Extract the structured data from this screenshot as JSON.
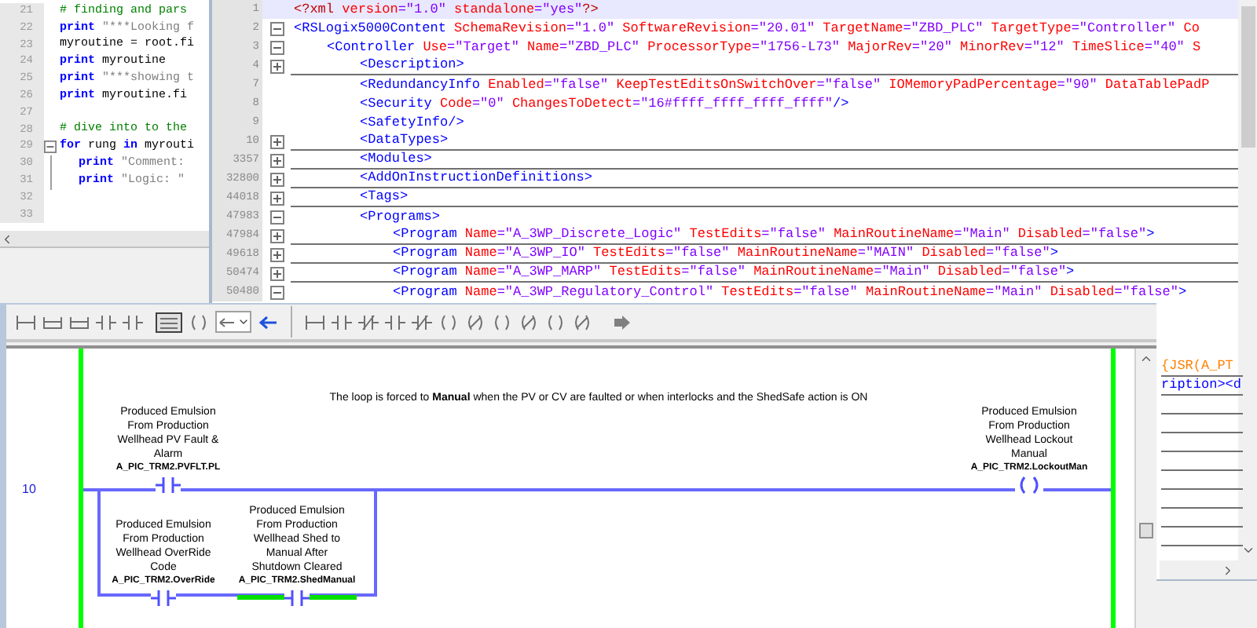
{
  "code_window": {
    "lines": [
      {
        "number": "21",
        "indent": false,
        "fold_marker": false,
        "tokens": [
          {
            "kind": "comment",
            "text": "# finding and pars"
          }
        ]
      },
      {
        "number": "22",
        "indent": false,
        "fold_marker": false,
        "tokens": [
          {
            "kind": "keyword",
            "text": "print"
          },
          {
            "kind": "string",
            "text": " \"***Looking f"
          }
        ]
      },
      {
        "number": "23",
        "indent": false,
        "fold_marker": false,
        "tokens": [
          {
            "kind": "plain",
            "text": "myroutine = root.fi"
          }
        ]
      },
      {
        "number": "24",
        "indent": false,
        "fold_marker": false,
        "tokens": [
          {
            "kind": "keyword",
            "text": "print"
          },
          {
            "kind": "plain",
            "text": " myroutine"
          }
        ]
      },
      {
        "number": "25",
        "indent": false,
        "fold_marker": false,
        "tokens": [
          {
            "kind": "keyword",
            "text": "print"
          },
          {
            "kind": "string",
            "text": " \"***showing t"
          }
        ]
      },
      {
        "number": "26",
        "indent": false,
        "fold_marker": false,
        "tokens": [
          {
            "kind": "keyword",
            "text": "print"
          },
          {
            "kind": "plain",
            "text": " myroutine.fi"
          }
        ]
      },
      {
        "number": "27",
        "indent": false,
        "fold_marker": false
      },
      {
        "number": "28",
        "indent": false,
        "fold_marker": false,
        "tokens": [
          {
            "kind": "comment",
            "text": "# dive into to the"
          }
        ]
      },
      {
        "number": "29",
        "indent": false,
        "fold_marker": true,
        "tokens": [
          {
            "kind": "keyword",
            "text": "for"
          },
          {
            "kind": "plain",
            "text": " rung "
          },
          {
            "kind": "keyword",
            "text": "in"
          },
          {
            "kind": "plain",
            "text": " myrouti"
          }
        ]
      },
      {
        "number": "30",
        "indent": true,
        "fold_marker": false,
        "tokens": [
          {
            "kind": "keyword",
            "text": "print"
          },
          {
            "kind": "string",
            "text": " \"Comment:"
          }
        ]
      },
      {
        "number": "31",
        "indent": true,
        "fold_marker": false,
        "tokens": [
          {
            "kind": "keyword",
            "text": "print"
          },
          {
            "kind": "string",
            "text": " \"Logic: \""
          }
        ]
      },
      {
        "number": "32",
        "indent": false,
        "fold_marker": false
      },
      {
        "number": "33",
        "indent": false,
        "fold_marker": false
      }
    ]
  },
  "xml_window": {
    "lines": [
      {
        "number": "1",
        "fold_marker": false,
        "collapsed": false,
        "current": true,
        "tokens": [
          {
            "kind": "pi",
            "text": "<?xml"
          },
          {
            "kind": "attr",
            "text": " version"
          },
          {
            "kind": "value",
            "text": "=\"1.0\""
          },
          {
            "kind": "attr",
            "text": " standalone"
          },
          {
            "kind": "value",
            "text": "=\"yes\""
          },
          {
            "kind": "pi",
            "text": "?>"
          }
        ]
      },
      {
        "number": "2",
        "fold_marker": true,
        "collapsed": false,
        "current": false,
        "tokens": [
          {
            "kind": "tag",
            "text": "<RSLogix5000Content"
          },
          {
            "kind": "attr",
            "text": " SchemaRevision"
          },
          {
            "kind": "value",
            "text": "=\"1.0\""
          },
          {
            "kind": "attr",
            "text": " SoftwareRevision"
          },
          {
            "kind": "value",
            "text": "=\"20.01\""
          },
          {
            "kind": "attr",
            "text": " TargetName"
          },
          {
            "kind": "value",
            "text": "=\"ZBD_PLC\""
          },
          {
            "kind": "attr",
            "text": " TargetType"
          },
          {
            "kind": "value",
            "text": "=\"Controller\""
          },
          {
            "kind": "attr",
            "text": " Co"
          }
        ],
        "children": [
          {
            "number": "3",
            "fold_marker": true,
            "collapsed": false,
            "current": false,
            "tokens": [
              {
                "kind": "tag",
                "text": "<Controller"
              },
              {
                "kind": "attr",
                "text": " Use"
              },
              {
                "kind": "value",
                "text": "=\"Target\""
              },
              {
                "kind": "attr",
                "text": " Name"
              },
              {
                "kind": "value",
                "text": "=\"ZBD_PLC\""
              },
              {
                "kind": "attr",
                "text": " ProcessorType"
              },
              {
                "kind": "value",
                "text": "=\"1756-L73\""
              },
              {
                "kind": "attr",
                "text": " MajorRev"
              },
              {
                "kind": "value",
                "text": "=\"20\""
              },
              {
                "kind": "attr",
                "text": " MinorRev"
              },
              {
                "kind": "value",
                "text": "=\"12\""
              },
              {
                "kind": "attr",
                "text": " TimeSlice"
              },
              {
                "kind": "value",
                "text": "=\"40\""
              },
              {
                "kind": "attr",
                "text": " S"
              }
            ],
            "children": [
              {
                "number": "4",
                "fold_marker": true,
                "collapsed": true,
                "current": false,
                "tokens": [
                  {
                    "kind": "tag",
                    "text": "<Description>"
                  }
                ]
              },
              {
                "number": "7",
                "fold_marker": false,
                "collapsed": false,
                "current": false,
                "tokens": [
                  {
                    "kind": "tag",
                    "text": "<RedundancyInfo"
                  },
                  {
                    "kind": "attr",
                    "text": " Enabled"
                  },
                  {
                    "kind": "value",
                    "text": "=\"false\""
                  },
                  {
                    "kind": "attr",
                    "text": " KeepTestEditsOnSwitchOver"
                  },
                  {
                    "kind": "value",
                    "text": "=\"false\""
                  },
                  {
                    "kind": "attr",
                    "text": " IOMemoryPadPercentage"
                  },
                  {
                    "kind": "value",
                    "text": "=\"90\""
                  },
                  {
                    "kind": "attr",
                    "text": " DataTablePadP"
                  }
                ]
              },
              {
                "number": "8",
                "fold_marker": false,
                "collapsed": false,
                "current": false,
                "tokens": [
                  {
                    "kind": "tag",
                    "text": "<Security"
                  },
                  {
                    "kind": "attr",
                    "text": " Code"
                  },
                  {
                    "kind": "value",
                    "text": "=\"0\""
                  },
                  {
                    "kind": "attr",
                    "text": " ChangesToDetect"
                  },
                  {
                    "kind": "value",
                    "text": "=\"16#ffff_ffff_ffff_ffff\""
                  },
                  {
                    "kind": "tag",
                    "text": "/>"
                  }
                ]
              },
              {
                "number": "9",
                "fold_marker": false,
                "collapsed": false,
                "current": false,
                "tokens": [
                  {
                    "kind": "tag",
                    "text": "<SafetyInfo/>"
                  }
                ]
              },
              {
                "number": "10",
                "fold_marker": true,
                "collapsed": true,
                "current": false,
                "tokens": [
                  {
                    "kind": "tag",
                    "text": "<DataTypes>"
                  }
                ]
              },
              {
                "number": "3357",
                "fold_marker": true,
                "collapsed": true,
                "current": false,
                "tokens": [
                  {
                    "kind": "tag",
                    "text": "<Modules>"
                  }
                ]
              },
              {
                "number": "32800",
                "fold_marker": true,
                "collapsed": true,
                "current": false,
                "tokens": [
                  {
                    "kind": "tag",
                    "text": "<AddOnInstructionDefinitions>"
                  }
                ]
              },
              {
                "number": "44018",
                "fold_marker": true,
                "collapsed": true,
                "current": false,
                "tokens": [
                  {
                    "kind": "tag",
                    "text": "<Tags>"
                  }
                ]
              },
              {
                "number": "47983",
                "fold_marker": true,
                "collapsed": false,
                "current": false,
                "tokens": [
                  {
                    "kind": "tag",
                    "text": "<Programs>"
                  }
                ],
                "children": [
                  {
                    "number": "47984",
                    "fold_marker": true,
                    "collapsed": true,
                    "current": false,
                    "tokens": [
                      {
                        "kind": "tag",
                        "text": "<Program"
                      },
                      {
                        "kind": "attr",
                        "text": " Name"
                      },
                      {
                        "kind": "value",
                        "text": "=\"A_3WP_Discrete_Logic\""
                      },
                      {
                        "kind": "attr",
                        "text": " TestEdits"
                      },
                      {
                        "kind": "value",
                        "text": "=\"false\""
                      },
                      {
                        "kind": "attr",
                        "text": " MainRoutineName"
                      },
                      {
                        "kind": "value",
                        "text": "=\"Main\""
                      },
                      {
                        "kind": "attr",
                        "text": " Disabled"
                      },
                      {
                        "kind": "value",
                        "text": "=\"false\""
                      },
                      {
                        "kind": "tag",
                        "text": ">"
                      }
                    ]
                  },
                  {
                    "number": "49618",
                    "fold_marker": true,
                    "collapsed": true,
                    "current": false,
                    "tokens": [
                      {
                        "kind": "tag",
                        "text": "<Program"
                      },
                      {
                        "kind": "attr",
                        "text": " Name"
                      },
                      {
                        "kind": "value",
                        "text": "=\"A_3WP_IO\""
                      },
                      {
                        "kind": "attr",
                        "text": " TestEdits"
                      },
                      {
                        "kind": "value",
                        "text": "=\"false\""
                      },
                      {
                        "kind": "attr",
                        "text": " MainRoutineName"
                      },
                      {
                        "kind": "value",
                        "text": "=\"MAIN\""
                      },
                      {
                        "kind": "attr",
                        "text": " Disabled"
                      },
                      {
                        "kind": "value",
                        "text": "=\"false\""
                      },
                      {
                        "kind": "tag",
                        "text": ">"
                      }
                    ]
                  },
                  {
                    "number": "50474",
                    "fold_marker": true,
                    "collapsed": true,
                    "current": false,
                    "tokens": [
                      {
                        "kind": "tag",
                        "text": "<Program"
                      },
                      {
                        "kind": "attr",
                        "text": " Name"
                      },
                      {
                        "kind": "value",
                        "text": "=\"A_3WP_MARP\""
                      },
                      {
                        "kind": "attr",
                        "text": " TestEdits"
                      },
                      {
                        "kind": "value",
                        "text": "=\"false\""
                      },
                      {
                        "kind": "attr",
                        "text": " MainRoutineName"
                      },
                      {
                        "kind": "value",
                        "text": "=\"Main\""
                      },
                      {
                        "kind": "attr",
                        "text": " Disabled"
                      },
                      {
                        "kind": "value",
                        "text": "=\"false\""
                      },
                      {
                        "kind": "tag",
                        "text": ">"
                      }
                    ]
                  },
                  {
                    "number": "50480",
                    "fold_marker": true,
                    "collapsed": false,
                    "current": false,
                    "tokens": [
                      {
                        "kind": "tag",
                        "text": "<Program"
                      },
                      {
                        "kind": "attr",
                        "text": " Name"
                      },
                      {
                        "kind": "value",
                        "text": "=\"A_3WP_Regulatory_Control\""
                      },
                      {
                        "kind": "attr",
                        "text": " TestEdits"
                      },
                      {
                        "kind": "value",
                        "text": "=\"false\""
                      },
                      {
                        "kind": "attr",
                        "text": " MainRoutineName"
                      },
                      {
                        "kind": "value",
                        "text": "=\"Main\""
                      },
                      {
                        "kind": "attr",
                        "text": " Disabled"
                      },
                      {
                        "kind": "value",
                        "text": "=\"false\""
                      },
                      {
                        "kind": "tag",
                        "text": ">"
                      }
                    ]
                  }
                ]
              }
            ]
          }
        ]
      }
    ],
    "fragments": [
      {
        "kind": "jsr",
        "text": "{JSR(A_PT"
      },
      {
        "kind": "tag",
        "text": "ription><d"
      }
    ]
  },
  "ladder_window": {
    "rung": {
      "number": "10",
      "comment": "The loop is forced to **Manual** when the PV or CV are faulted or when interlocks and the ShedSafe action is ON",
      "main": [
        {
          "kind": "contact",
          "energized": false,
          "description": [
            "Produced Emulsion",
            "From Production",
            "Wellhead PV Fault &",
            "Alarm"
          ],
          "tag": "A_PIC_TRM2.PVFLT.PL"
        }
      ],
      "branch": [
        {
          "kind": "contact",
          "energized": false,
          "description": [
            "Produced Emulsion",
            "From Production",
            "Wellhead OverRide",
            "Code"
          ],
          "tag": "A_PIC_TRM2.OverRide"
        },
        {
          "kind": "contact",
          "energized": true,
          "description": [
            "Produced Emulsion",
            "From Production",
            "Wellhead Shed to",
            "Manual After",
            "Shutdown Cleared"
          ],
          "tag": "A_PIC_TRM2.ShedManual"
        }
      ],
      "output": {
        "kind": "coil",
        "energized": false,
        "description": [
          "Produced Emulsion",
          "From Production",
          "Wellhead Lockout",
          "Manual"
        ],
        "tag": "A_PIC_TRM2.LockoutMan"
      }
    }
  }
}
